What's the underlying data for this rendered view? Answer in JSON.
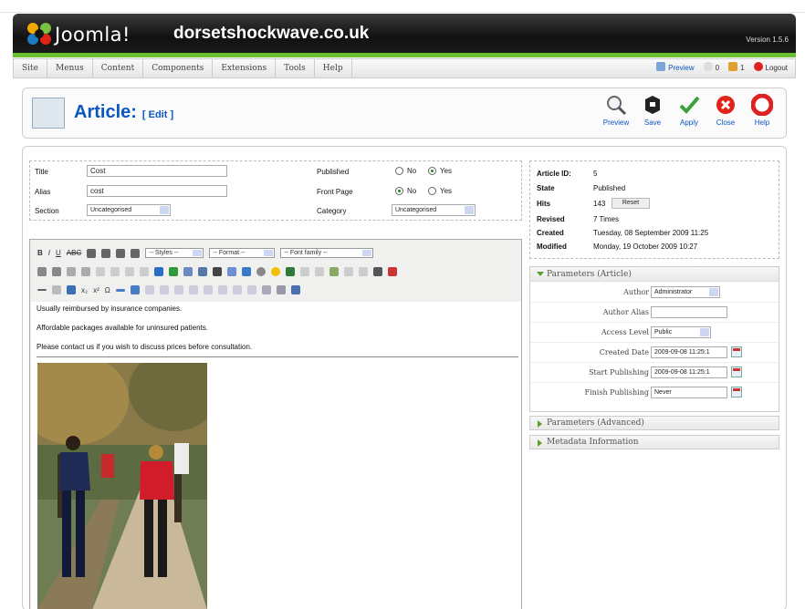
{
  "header": {
    "brand": "Joomla!",
    "site": "dorsetshockwave.co.uk",
    "version": "Version 1.5.6"
  },
  "menu": [
    "Site",
    "Menus",
    "Content",
    "Components",
    "Extensions",
    "Tools",
    "Help"
  ],
  "status": {
    "preview": "Preview",
    "messages": "0",
    "users": "1",
    "logout": "Logout"
  },
  "toolbar": {
    "title": "Article:",
    "mode": "[ Edit ]",
    "buttons": [
      {
        "label": "Preview",
        "icon": "magnifier-icon"
      },
      {
        "label": "Save",
        "icon": "save-icon"
      },
      {
        "label": "Apply",
        "icon": "apply-icon"
      },
      {
        "label": "Close",
        "icon": "close-icon"
      },
      {
        "label": "Help",
        "icon": "help-icon"
      }
    ]
  },
  "form": {
    "title_label": "Title",
    "title_value": "Cost",
    "alias_label": "Alias",
    "alias_value": "cost",
    "section_label": "Section",
    "section_value": "Uncategorised",
    "published_label": "Published",
    "frontpage_label": "Front Page",
    "category_label": "Category",
    "category_value": "Uncategorised",
    "no": "No",
    "yes": "Yes",
    "published": "yes",
    "frontpage": "no"
  },
  "editor": {
    "styles": "-- Styles --",
    "format": "-- Format --",
    "fontfamily": "-- Font family --",
    "paragraphs": [
      "Usually reimbursed by insurance companies.",
      "Affordable packages available for uninsured patients.",
      "Please contact us if you wish to discuss prices before consultation."
    ]
  },
  "info": {
    "id_label": "Article ID:",
    "id_value": "5",
    "state_label": "State",
    "state_value": "Published",
    "hits_label": "Hits",
    "hits_value": "143",
    "reset": "Reset",
    "revised_label": "Revised",
    "revised_value": "7 Times",
    "created_label": "Created",
    "created_value": "Tuesday, 08 September 2009 11:25",
    "modified_label": "Modified",
    "modified_value": "Monday, 19 October 2009 10:27"
  },
  "params": {
    "heading": "Parameters (Article)",
    "author_label": "Author",
    "author_value": "Administrator",
    "alias_label": "Author Alias",
    "alias_value": "",
    "access_label": "Access Level",
    "access_value": "Public",
    "created_label": "Created Date",
    "created_value": "2009-09-08 11:25:1",
    "start_label": "Start Publishing",
    "start_value": "2009-09-08 11:25:1",
    "finish_label": "Finish Publishing",
    "finish_value": "Never"
  },
  "advanced": "Parameters (Advanced)",
  "metadata": "Metadata Information",
  "colors": {
    "joomla_blue": "#0b55c4",
    "accent_green": "#6bbf32",
    "header_black": "#1a1a1a"
  }
}
